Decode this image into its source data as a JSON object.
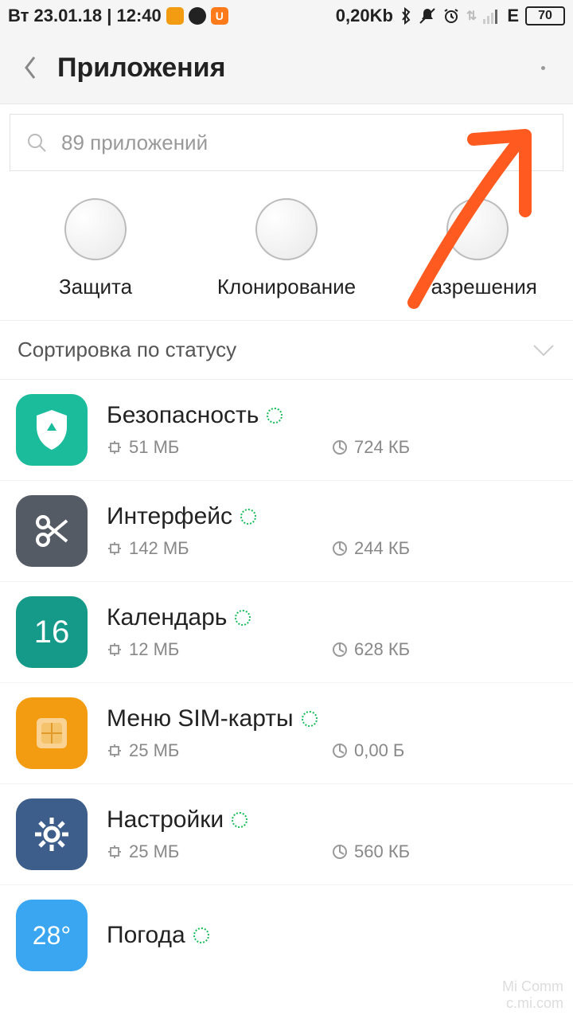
{
  "status": {
    "datetime": "Вт 23.01.18 | 12:40",
    "data_rate": "0,20Kb",
    "network": "E",
    "battery": "70"
  },
  "header": {
    "title": "Приложения"
  },
  "search": {
    "placeholder": "89 приложений"
  },
  "quick": [
    {
      "label": "Защита",
      "name": "quick-security"
    },
    {
      "label": "Клонирование",
      "name": "quick-clone"
    },
    {
      "label": "Разрешения",
      "name": "quick-permissions"
    }
  ],
  "sort": {
    "label": "Сортировка по статусу"
  },
  "apps": [
    {
      "name": "Безопасность",
      "storage": "51 МБ",
      "data": "724 КБ",
      "iconClass": "green",
      "glyph": "shield"
    },
    {
      "name": "Интерфейс",
      "storage": "142 МБ",
      "data": "244 КБ",
      "iconClass": "grey",
      "glyph": "scissors"
    },
    {
      "name": "Календарь",
      "storage": "12 МБ",
      "data": "628 КБ",
      "iconClass": "teal",
      "glyph": "cal"
    },
    {
      "name": "Меню SIM-карты",
      "storage": "25 МБ",
      "data": "0,00 Б",
      "iconClass": "orangei",
      "glyph": "sim"
    },
    {
      "name": "Настройки",
      "storage": "25 МБ",
      "data": "560 КБ",
      "iconClass": "bluei",
      "glyph": "gear"
    },
    {
      "name": "Погода",
      "storage": "",
      "data": "",
      "iconClass": "skyi",
      "glyph": "weather"
    }
  ],
  "watermark": {
    "l1": "Mi Comm",
    "l2": "c.mi.com"
  }
}
